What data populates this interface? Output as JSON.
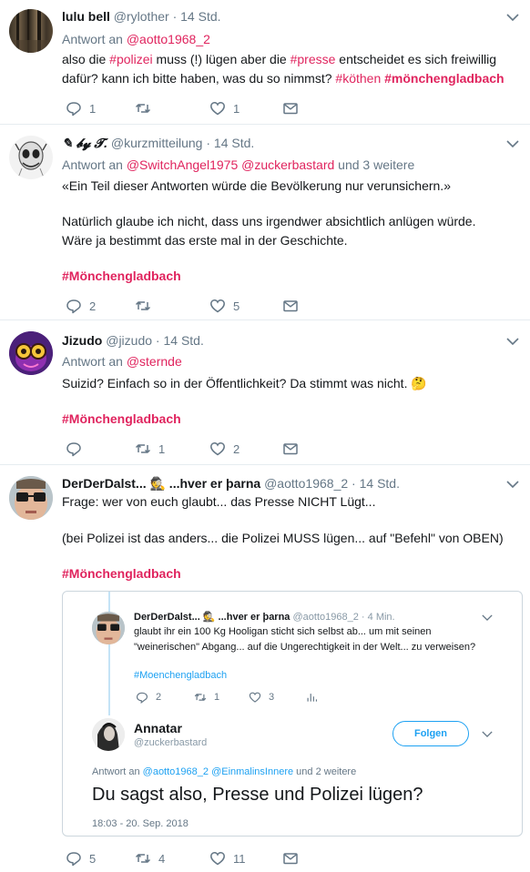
{
  "tweets": [
    {
      "name": "lulu bell",
      "handle": "@rylother",
      "dot": "·",
      "time": "14 Std.",
      "reply_prefix": "Antwort an",
      "reply_users": [
        "@aotto1968_2"
      ],
      "reply_suffix": "",
      "text_parts": [
        "also die ",
        "#polizei",
        " muss (!) lügen aber die ",
        "#presse",
        " entscheidet es sich freiwillig",
        "dafür? kann ich bitte haben, was du so nimmst? ",
        "#köthen",
        "#mönchengladbach"
      ],
      "reply_count": "1",
      "retweet_count": "",
      "like_count": "1"
    },
    {
      "name": "✎ 𝓫𝔂 𝓣.",
      "handle": "@kurzmitteilung",
      "dot": "·",
      "time": "14 Std.",
      "reply_prefix": "Antwort an",
      "reply_users": [
        "@SwitchAngel1975",
        "@zuckerbastard"
      ],
      "reply_suffix": "und 3 weitere",
      "line1": "«Ein Teil dieser Antworten würde die Bevölkerung nur verunsichern.»",
      "line2": "Natürlich glaube ich nicht, dass uns irgendwer absichtlich anlügen würde.",
      "line3": "Wäre ja bestimmt das erste mal in der Geschichte.",
      "hashtag": "#Mönchengladbach",
      "reply_count": "2",
      "retweet_count": "",
      "like_count": "5"
    },
    {
      "name": "Jizudo",
      "handle": "@jizudo",
      "dot": "·",
      "time": "14 Std.",
      "reply_prefix": "Antwort an",
      "reply_users": [
        "@sternde"
      ],
      "line1": "Suizid? Einfach so in der Öffentlichkeit? Da stimmt was nicht.",
      "emoji": "🤔",
      "hashtag": "#Mönchengladbach",
      "reply_count": "",
      "retweet_count": "1",
      "like_count": "2"
    },
    {
      "name": "DerDerDalst... 🕵 ...hver er þarna",
      "handle": "@aotto1968_2",
      "dot": "·",
      "time": "14 Std.",
      "line1": "Frage: wer von euch glaubt... das Presse NICHT Lügt...",
      "line2": "(bei Polizei ist das anders... die Polizei MUSS lügen... auf \"Befehl\" von OBEN)",
      "hashtag": "#Mönchengladbach",
      "reply_count": "5",
      "retweet_count": "4",
      "like_count": "11"
    }
  ],
  "embed": {
    "quoted": {
      "name": "DerDerDalst... 🕵 ...hver er þarna",
      "handle": "@aotto1968_2",
      "dot": "·",
      "time": "4 Min.",
      "line1": "glaubt ihr ein 100 Kg Hooligan sticht sich selbst ab... um mit seinen",
      "line2": "\"weinerischen\" Abgang... auf die Ungerechtigkeit in der Welt... zu verweisen?",
      "hashtag": "#Moenchengladbach",
      "reply_count": "2",
      "retweet_count": "1",
      "like_count": "3"
    },
    "main": {
      "name": "Annatar",
      "handle": "@zuckerbastard",
      "follow_label": "Folgen",
      "reply_prefix": "Antwort an",
      "reply_users": [
        "@aotto1968_2",
        "@EinmalinsInnere"
      ],
      "reply_suffix": "und 2 weitere",
      "big_text": "Du sagst also, Presse und Polizei lügen?",
      "timestamp": "18:03 - 20. Sep. 2018"
    }
  },
  "colors": {
    "accent": "#e0245e",
    "link_blue": "#1da1f2",
    "muted": "#657786",
    "border": "#e6ecf0"
  }
}
